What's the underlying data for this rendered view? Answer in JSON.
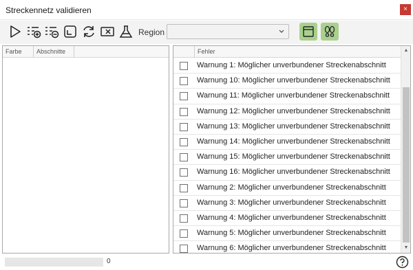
{
  "window": {
    "title": "Streckennetz validieren",
    "close_glyph": "×"
  },
  "toolbar": {
    "icons": [
      "play-icon",
      "add-list-icon",
      "remove-list-icon",
      "crop-icon",
      "refresh-icon",
      "clear-field-icon",
      "flask-icon"
    ],
    "region_label": "Region",
    "region_value": "",
    "toggles": [
      "single-panel-layout-icon",
      "footprints-icon"
    ],
    "toggle_color": "#a9d08e"
  },
  "left_panel": {
    "columns": [
      "Farbe",
      "Abschnitte"
    ],
    "rows": []
  },
  "right_panel": {
    "column_header": "Fehler",
    "rows": [
      "Warnung 1: Möglicher unverbundener Streckenabschnitt",
      "Warnung 10: Möglicher unverbundener Streckenabschnitt",
      "Warnung 11: Möglicher unverbundener Streckenabschnitt",
      "Warnung 12: Möglicher unverbundener Streckenabschnitt",
      "Warnung 13: Möglicher unverbundener Streckenabschnitt",
      "Warnung 14: Möglicher unverbundener Streckenabschnitt",
      "Warnung 15: Möglicher unverbundener Streckenabschnitt",
      "Warnung 16: Möglicher unverbundener Streckenabschnitt",
      "Warnung 2: Möglicher unverbundener Streckenabschnitt",
      "Warnung 3: Möglicher unverbundener Streckenabschnitt",
      "Warnung 4: Möglicher unverbundener Streckenabschnitt",
      "Warnung 5: Möglicher unverbundener Streckenabschnitt",
      "Warnung 6: Möglicher unverbundener Streckenabschnitt"
    ]
  },
  "status": {
    "progress_fraction": 0,
    "progress_value": "0",
    "help_icon": "help-icon"
  },
  "colors": {
    "close": "#c53a33",
    "toggle_active": "#a9d08e"
  }
}
